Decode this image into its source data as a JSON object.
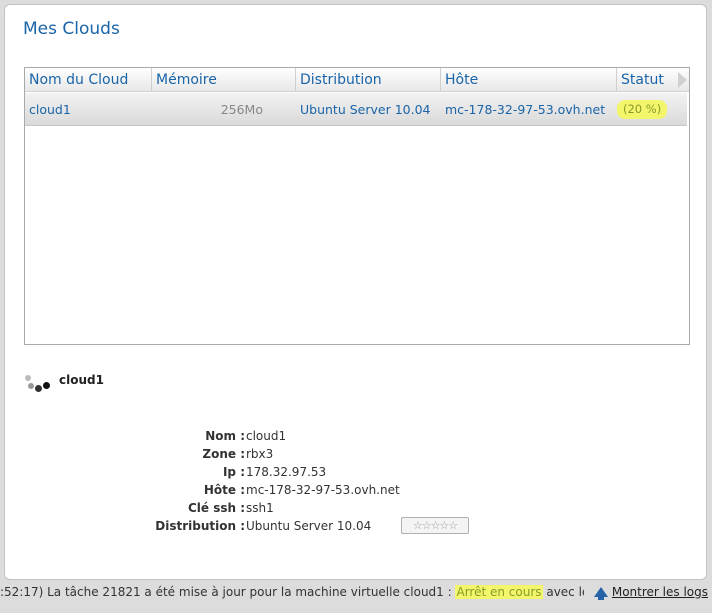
{
  "page": {
    "title": "Mes Clouds"
  },
  "grid": {
    "columns": [
      "Nom du Cloud",
      "Mémoire",
      "Distribution",
      "Hôte",
      "Statut"
    ],
    "rows": [
      {
        "name": "cloud1",
        "memory": "256Mo",
        "distribution": "Ubuntu Server 10.04",
        "host": "mc-178-32-97-53.ovh.net",
        "status": "(20 %)"
      }
    ]
  },
  "detail": {
    "title": "cloud1",
    "fields": [
      {
        "label": "Nom :",
        "value": "cloud1"
      },
      {
        "label": "Zone :",
        "value": "rbx3"
      },
      {
        "label": "Ip :",
        "value": "178.32.97.53"
      },
      {
        "label": "Hôte :",
        "value": "mc-178-32-97-53.ovh.net"
      },
      {
        "label": "Clé ssh :",
        "value": "ssh1"
      },
      {
        "label": "Distribution :",
        "value": "Ubuntu Server 10.04"
      }
    ],
    "rating_stars": "☆☆☆☆☆"
  },
  "statusbar": {
    "message_before": ":52:17) La tâche 21821 a été mise à jour pour la machine virtuelle cloud1 : ",
    "highlight": "Arrêt en cours",
    "message_after": " avec le",
    "show_logs": "Montrer les logs"
  },
  "colors": {
    "accent": "#1a64a8",
    "highlight": "#f3f66a"
  }
}
